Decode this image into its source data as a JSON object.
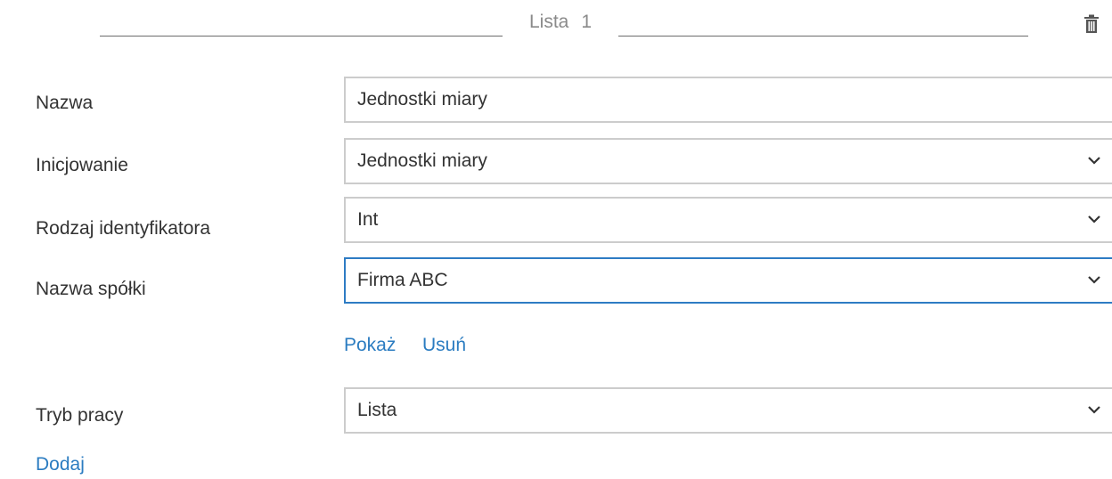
{
  "section": {
    "title": "Lista",
    "number": "1",
    "delete_icon": "trash-icon"
  },
  "form": {
    "name": {
      "label": "Nazwa",
      "value": "Jednostki miary"
    },
    "initialization": {
      "label": "Inicjowanie",
      "value": "Jednostki miary"
    },
    "id_type": {
      "label": "Rodzaj identyfikatora",
      "value": "Int"
    },
    "company": {
      "label": "Nazwa spółki",
      "value": "Firma ABC"
    },
    "work_mode": {
      "label": "Tryb pracy",
      "value": "Lista"
    }
  },
  "company_actions": {
    "show_label": "Pokaż",
    "remove_label": "Usuń"
  },
  "add_label": "Dodaj",
  "colors": {
    "accent": "#2b7cc1",
    "focus_border": "#2e7cc4",
    "border": "#cccccc"
  },
  "icons": {
    "dropdown": "chevron-down-icon"
  }
}
